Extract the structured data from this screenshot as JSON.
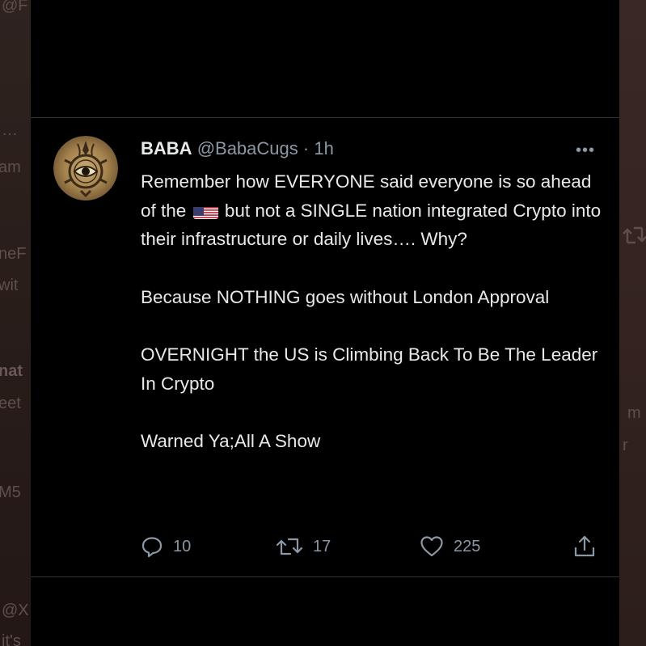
{
  "background_fragments": {
    "left": [
      "@F",
      "…",
      "am",
      "neF",
      "wit",
      "nat",
      "eet",
      "M5",
      "@X",
      "it's"
    ],
    "right": [
      "m",
      "r"
    ]
  },
  "tweet": {
    "author_name": "BABA",
    "handle": "@BabaCugs",
    "separator": "·",
    "time": "1h",
    "more_label": "•••",
    "body": {
      "p1_part1": "Remember how EVERYONE said everyone is so ahead of the",
      "p1_flag": "us-flag-emoji",
      "p1_part2": "but not a SINGLE nation integrated Crypto into their infrastructure or daily lives…. Why?",
      "p2": "Because NOTHING goes without London Approval",
      "p3": "OVERNIGHT the US is Climbing Back To Be The Leader In Crypto",
      "p4": "Warned Ya;All A Show"
    },
    "stats": {
      "replies": "10",
      "retweets": "17",
      "likes": "225"
    },
    "icons": {
      "reply": "reply-icon",
      "retweet": "retweet-icon",
      "like": "heart-icon",
      "share": "share-icon"
    }
  },
  "colors": {
    "background": "#000000",
    "text_primary": "#e7e9ea",
    "text_secondary": "#8b98a5",
    "divider": "#2f3336"
  }
}
